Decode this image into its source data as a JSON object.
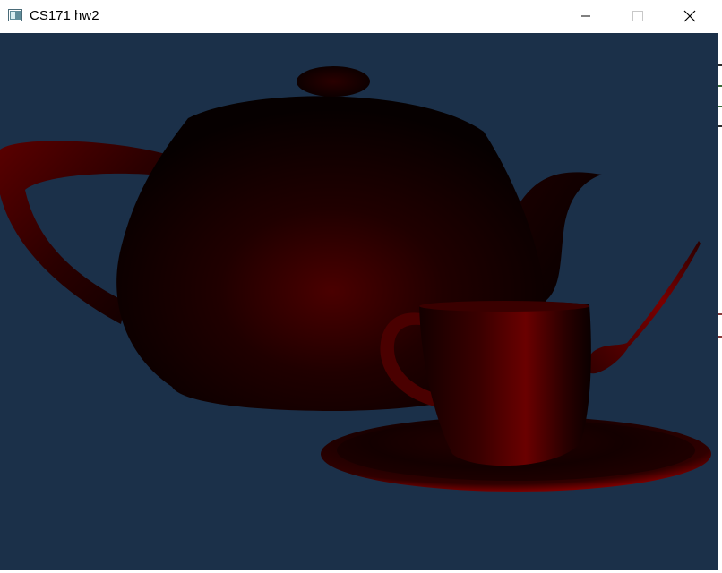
{
  "window": {
    "title": "CS171 hw2",
    "app_icon": "console-window-icon",
    "controls": [
      "minimize-icon",
      "maximize-icon",
      "close-icon"
    ]
  },
  "scene": {
    "background_color": "#1b3049",
    "objects": [
      "teapot",
      "teacup",
      "saucer",
      "spoon"
    ],
    "material_color": "#7a0000"
  },
  "colors": {
    "titlebar": "#ffffff",
    "title_text": "#000000"
  }
}
